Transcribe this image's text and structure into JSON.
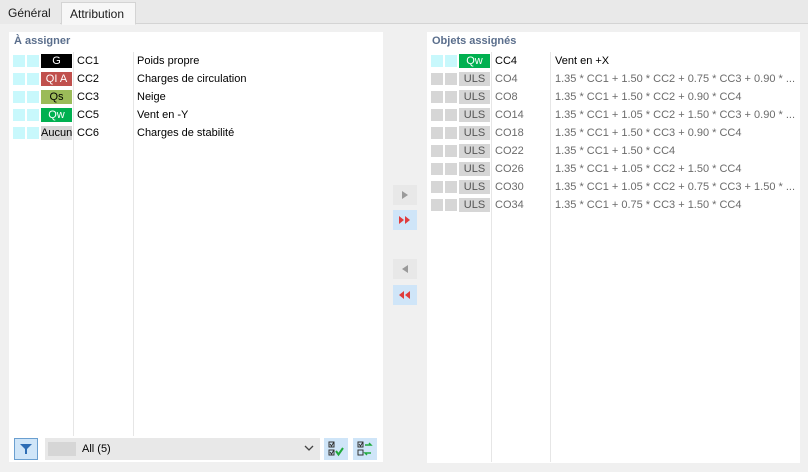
{
  "tabs": [
    {
      "label": "Général",
      "active": false
    },
    {
      "label": "Attribution",
      "active": true
    }
  ],
  "left_panel": {
    "title": "À assigner",
    "rows": [
      {
        "badge": "G",
        "badge_bg": "#000000",
        "badge_fg": "#ffffff",
        "id": "CC1",
        "desc": "Poids propre"
      },
      {
        "badge": "QI A",
        "badge_bg": "#c0504d",
        "badge_fg": "#ffffff",
        "id": "CC2",
        "desc": "Charges de circulation"
      },
      {
        "badge": "Qs",
        "badge_bg": "#9bbb59",
        "badge_fg": "#000000",
        "id": "CC3",
        "desc": "Neige"
      },
      {
        "badge": "Qw",
        "badge_bg": "#00b050",
        "badge_fg": "#ffffff",
        "id": "CC5",
        "desc": "Vent en -Y"
      },
      {
        "badge": "Aucun",
        "badge_bg": "#d6d6d6",
        "badge_fg": "#000000",
        "id": "CC6",
        "desc": "Charges de stabilité"
      }
    ],
    "filter": {
      "selected": "All (5)"
    }
  },
  "right_panel": {
    "title": "Objets assignés",
    "rows": [
      {
        "badge": "Qw",
        "badge_bg": "#00b050",
        "badge_fg": "#ffffff",
        "id": "CC4",
        "desc": "Vent en +X",
        "dim": false
      },
      {
        "badge": "ULS",
        "badge_bg": "#d6d6d6",
        "badge_fg": "#555555",
        "id": "CO4",
        "desc": "1.35 * CC1 + 1.50 * CC2 + 0.75 * CC3 + 0.90 * ...",
        "dim": true
      },
      {
        "badge": "ULS",
        "badge_bg": "#d6d6d6",
        "badge_fg": "#555555",
        "id": "CO8",
        "desc": "1.35 * CC1 + 1.50 * CC2 + 0.90 * CC4",
        "dim": true
      },
      {
        "badge": "ULS",
        "badge_bg": "#d6d6d6",
        "badge_fg": "#555555",
        "id": "CO14",
        "desc": "1.35 * CC1 + 1.05 * CC2 + 1.50 * CC3 + 0.90 * ...",
        "dim": true
      },
      {
        "badge": "ULS",
        "badge_bg": "#d6d6d6",
        "badge_fg": "#555555",
        "id": "CO18",
        "desc": "1.35 * CC1 + 1.50 * CC3 + 0.90 * CC4",
        "dim": true
      },
      {
        "badge": "ULS",
        "badge_bg": "#d6d6d6",
        "badge_fg": "#555555",
        "id": "CO22",
        "desc": "1.35 * CC1 + 1.50 * CC4",
        "dim": true
      },
      {
        "badge": "ULS",
        "badge_bg": "#d6d6d6",
        "badge_fg": "#555555",
        "id": "CO26",
        "desc": "1.35 * CC1 + 1.05 * CC2 + 1.50 * CC4",
        "dim": true
      },
      {
        "badge": "ULS",
        "badge_bg": "#d6d6d6",
        "badge_fg": "#555555",
        "id": "CO30",
        "desc": "1.35 * CC1 + 1.05 * CC2 + 0.75 * CC3 + 1.50 * ...",
        "dim": true
      },
      {
        "badge": "ULS",
        "badge_bg": "#d6d6d6",
        "badge_fg": "#555555",
        "id": "CO34",
        "desc": "1.35 * CC1 + 0.75 * CC3 + 1.50 * CC4",
        "dim": true
      }
    ]
  },
  "transfer_buttons": [
    {
      "name": "assign-selected-button",
      "icon": "arrow-right-icon",
      "enabled": false
    },
    {
      "name": "assign-all-button",
      "icon": "double-arrow-right-icon",
      "enabled": true
    },
    {
      "name": "unassign-selected-button",
      "icon": "arrow-left-icon",
      "enabled": false
    },
    {
      "name": "unassign-all-button",
      "icon": "double-arrow-left-icon",
      "enabled": true
    }
  ],
  "colors": {
    "title": "#5a6e8c",
    "cyan_square": "#c8f8fc",
    "button_active": "#cfe5f8",
    "double_arrow": "#e03c3c"
  }
}
